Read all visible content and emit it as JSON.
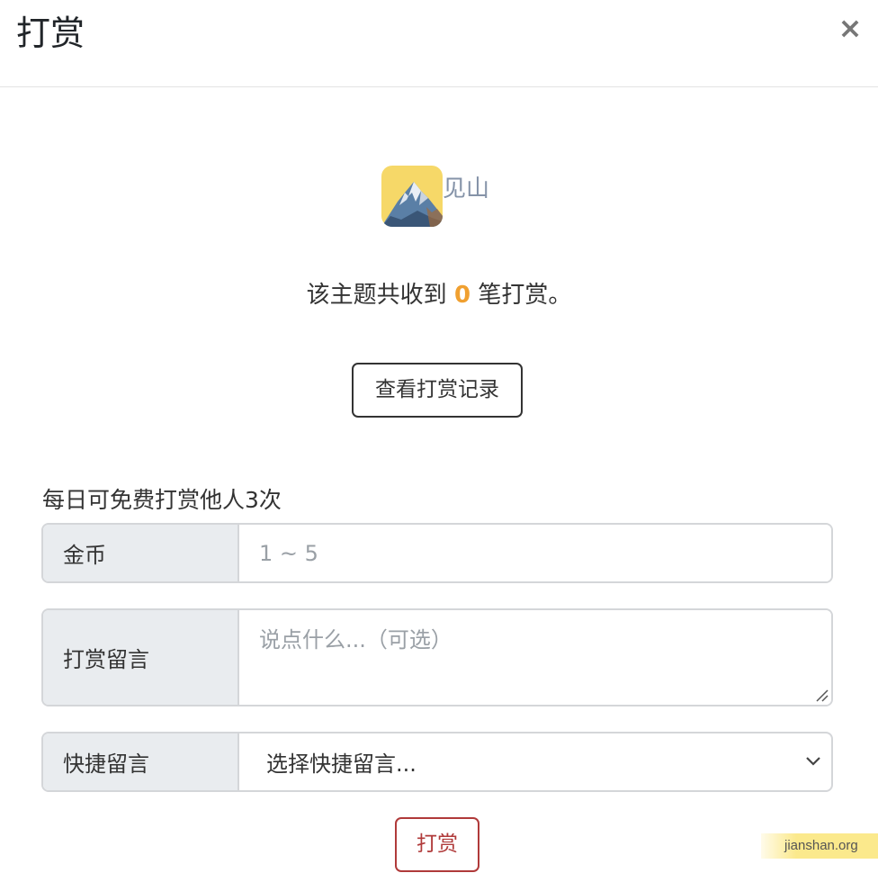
{
  "header": {
    "title": "打赏",
    "close_symbol": "×"
  },
  "author": {
    "name": "见山",
    "avatar_icon": "mountain-avatar-icon"
  },
  "stats": {
    "prefix": "该主题共收到",
    "count": "0",
    "suffix": "笔打赏。"
  },
  "history_button": "查看打赏记录",
  "free_note": "每日可免费打赏他人3次",
  "form": {
    "coins_label": "金币",
    "coins_placeholder": "1 ~ 5",
    "message_label": "打赏留言",
    "message_placeholder": "说点什么...（可选）",
    "quick_label": "快捷留言",
    "quick_selected": "选择快捷留言..."
  },
  "submit_button": "打赏",
  "watermark": "jianshan.org",
  "colors": {
    "count_accent": "#f0a030",
    "submit_accent": "#b03a3a",
    "author_name": "#8593a8"
  }
}
